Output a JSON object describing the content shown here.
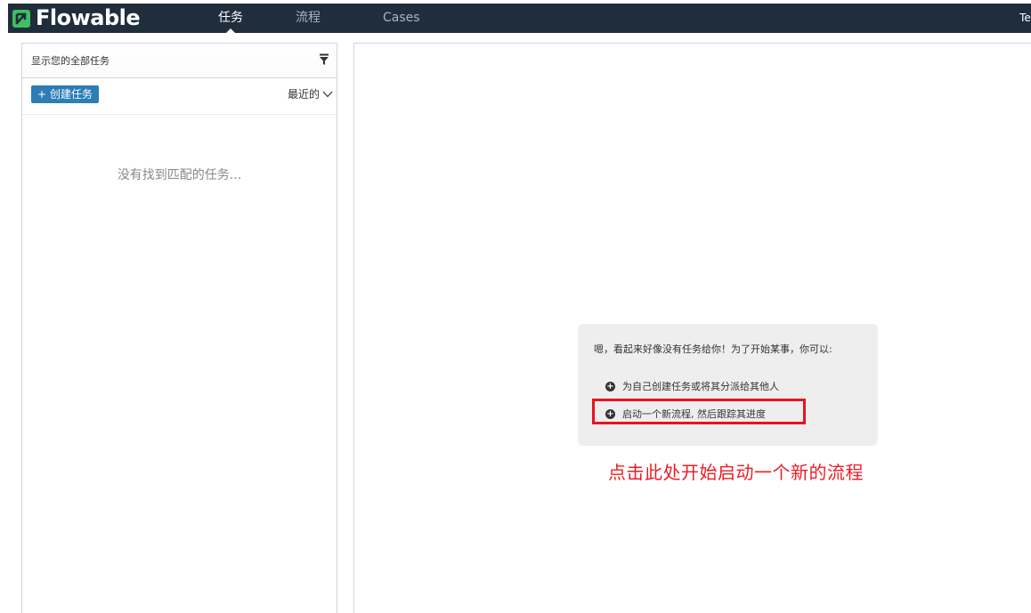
{
  "navbar": {
    "logo": "Flowable",
    "tabs": [
      {
        "label": "任务",
        "active": true
      },
      {
        "label": "流程",
        "active": false
      },
      {
        "label": "Cases",
        "active": false
      }
    ],
    "user": "Tes"
  },
  "task_list": {
    "filter_label": "显示您的全部任务",
    "create_button": "+ 创建任务",
    "sort_label": "最近的",
    "empty_message": "没有找到匹配的任务..."
  },
  "help": {
    "intro": "嗯，看起来好像没有任务给你！为了开始某事，你可以:",
    "option_create": "为自己创建任务或将其分派给其他人",
    "option_start": "启动一个新流程, 然后跟踪其进度"
  },
  "annotation": "点击此处开始启动一个新的流程",
  "colors": {
    "navbar": "#1f2d3c",
    "accent": "#2d7db6",
    "highlight": "#e8121f"
  }
}
